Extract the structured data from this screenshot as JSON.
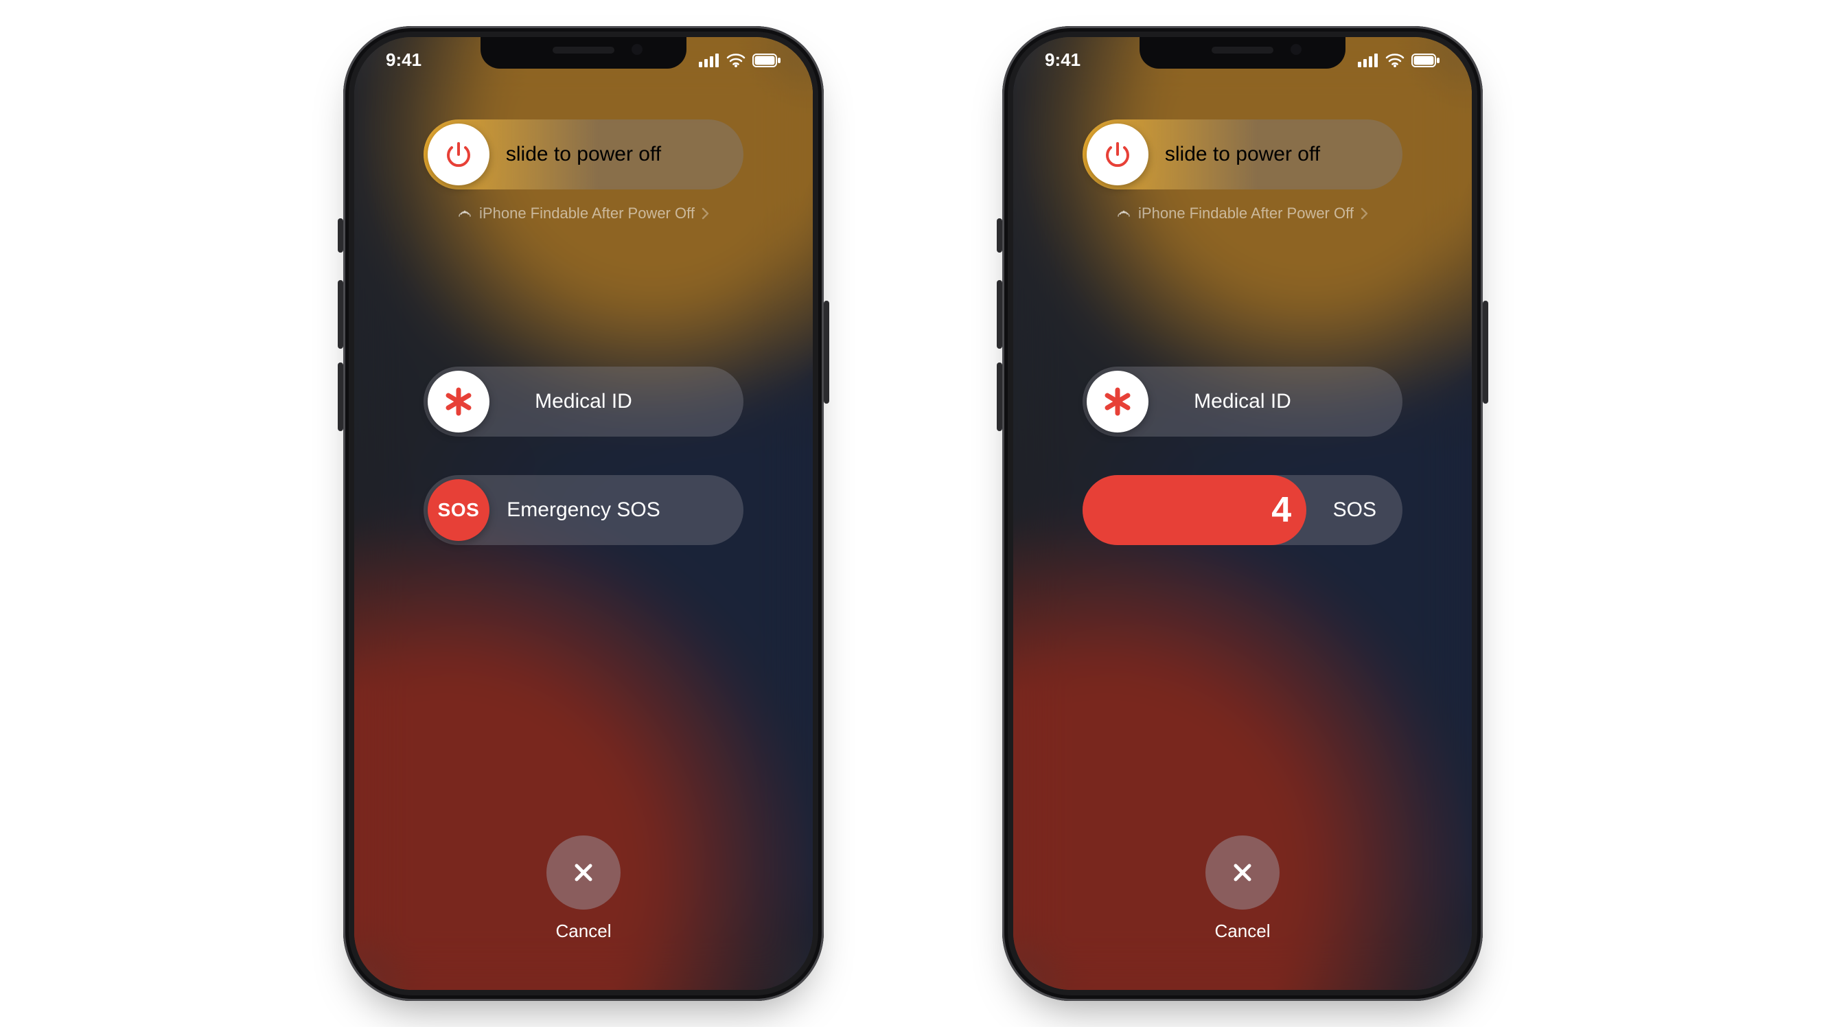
{
  "status": {
    "time": "9:41"
  },
  "power_off": {
    "label": "slide to power off"
  },
  "findable": {
    "text": "iPhone Findable After Power Off"
  },
  "medical": {
    "label": "Medical ID"
  },
  "sos": {
    "label": "Emergency SOS",
    "knob_text": "SOS"
  },
  "cancel": {
    "label": "Cancel"
  },
  "phone2": {
    "sos_trail": "SOS",
    "countdown": "4"
  },
  "colors": {
    "red": "#e74037",
    "amber": "#e6a92f"
  }
}
